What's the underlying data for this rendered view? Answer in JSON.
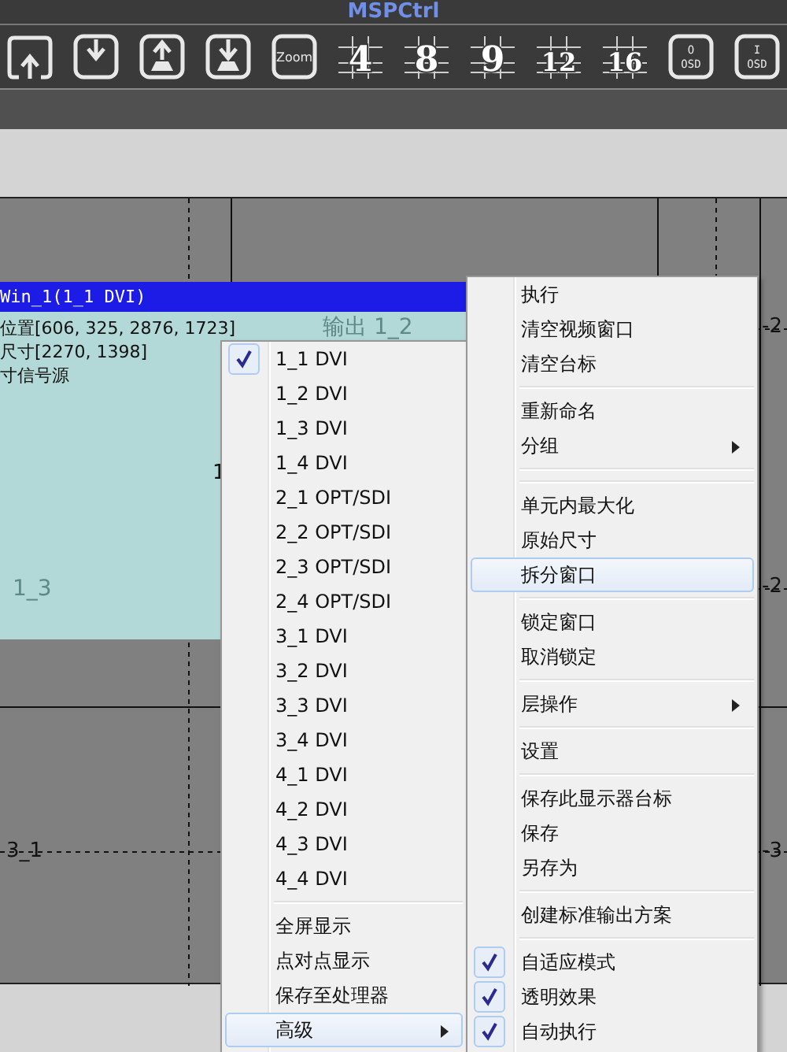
{
  "window": {
    "title": "MSPCtrl"
  },
  "toolbar": [
    {
      "kind": "frame-up"
    },
    {
      "kind": "tray-down"
    },
    {
      "kind": "tray-up"
    },
    {
      "kind": "tray-in"
    },
    {
      "kind": "zoom",
      "label": "Zoom"
    },
    {
      "kind": "grid",
      "label": "4"
    },
    {
      "kind": "grid",
      "label": "8"
    },
    {
      "kind": "grid",
      "label": "9"
    },
    {
      "kind": "grid",
      "label": "12"
    },
    {
      "kind": "grid",
      "label": "16"
    },
    {
      "kind": "osd",
      "label": "O",
      "sub": "OSD"
    },
    {
      "kind": "osd",
      "label": "I",
      "sub": "OSD"
    }
  ],
  "canvas": {
    "labels": [
      "输出 1_2",
      "1",
      "1_3",
      "-2",
      "-2",
      "3_1",
      "-3"
    ],
    "video_window": {
      "title": "Win_1(1_1 DVI)",
      "lines": [
        "位置[606, 325, 2876, 1723]",
        "尺寸[2270, 1398]",
        "寸信号源"
      ]
    }
  },
  "source_menu": {
    "items": [
      {
        "kind": "item",
        "label": "1_1 DVI",
        "checked": true,
        "selected": false,
        "submenu": false
      },
      {
        "kind": "item",
        "label": "1_2 DVI",
        "checked": false,
        "selected": false,
        "submenu": false
      },
      {
        "kind": "item",
        "label": "1_3 DVI",
        "checked": false,
        "selected": false,
        "submenu": false
      },
      {
        "kind": "item",
        "label": "1_4 DVI",
        "checked": false,
        "selected": false,
        "submenu": false
      },
      {
        "kind": "item",
        "label": "2_1 OPT/SDI",
        "checked": false,
        "selected": false,
        "submenu": false
      },
      {
        "kind": "item",
        "label": "2_2 OPT/SDI",
        "checked": false,
        "selected": false,
        "submenu": false
      },
      {
        "kind": "item",
        "label": "2_3 OPT/SDI",
        "checked": false,
        "selected": false,
        "submenu": false
      },
      {
        "kind": "item",
        "label": "2_4 OPT/SDI",
        "checked": false,
        "selected": false,
        "submenu": false
      },
      {
        "kind": "item",
        "label": "3_1 DVI",
        "checked": false,
        "selected": false,
        "submenu": false
      },
      {
        "kind": "item",
        "label": "3_2 DVI",
        "checked": false,
        "selected": false,
        "submenu": false
      },
      {
        "kind": "item",
        "label": "3_3 DVI",
        "checked": false,
        "selected": false,
        "submenu": false
      },
      {
        "kind": "item",
        "label": "3_4 DVI",
        "checked": false,
        "selected": false,
        "submenu": false
      },
      {
        "kind": "item",
        "label": "4_1 DVI",
        "checked": false,
        "selected": false,
        "submenu": false
      },
      {
        "kind": "item",
        "label": "4_2 DVI",
        "checked": false,
        "selected": false,
        "submenu": false
      },
      {
        "kind": "item",
        "label": "4_3 DVI",
        "checked": false,
        "selected": false,
        "submenu": false
      },
      {
        "kind": "item",
        "label": "4_4 DVI",
        "checked": false,
        "selected": false,
        "submenu": false
      },
      {
        "kind": "separator"
      },
      {
        "kind": "item",
        "label": "全屏显示",
        "checked": false,
        "selected": false,
        "submenu": false
      },
      {
        "kind": "item",
        "label": "点对点显示",
        "checked": false,
        "selected": false,
        "submenu": false
      },
      {
        "kind": "item",
        "label": "保存至处理器",
        "checked": false,
        "selected": false,
        "submenu": false
      },
      {
        "kind": "item",
        "label": "高级",
        "checked": false,
        "selected": true,
        "submenu": true
      }
    ]
  },
  "context_menu": {
    "items": [
      {
        "kind": "item",
        "label": "执行",
        "checked": false,
        "selected": false,
        "submenu": false
      },
      {
        "kind": "item",
        "label": "清空视频窗口",
        "checked": false,
        "selected": false,
        "submenu": false
      },
      {
        "kind": "item",
        "label": "清空台标",
        "checked": false,
        "selected": false,
        "submenu": false
      },
      {
        "kind": "separator"
      },
      {
        "kind": "item",
        "label": "重新命名",
        "checked": false,
        "selected": false,
        "submenu": false
      },
      {
        "kind": "item",
        "label": "分组",
        "checked": false,
        "selected": false,
        "submenu": true
      },
      {
        "kind": "separator"
      },
      {
        "kind": "separator"
      },
      {
        "kind": "item",
        "label": "单元内最大化",
        "checked": false,
        "selected": false,
        "submenu": false
      },
      {
        "kind": "item",
        "label": "原始尺寸",
        "checked": false,
        "selected": false,
        "submenu": false
      },
      {
        "kind": "item",
        "label": "拆分窗口",
        "checked": false,
        "selected": true,
        "submenu": false
      },
      {
        "kind": "separator"
      },
      {
        "kind": "item",
        "label": "锁定窗口",
        "checked": false,
        "selected": false,
        "submenu": false
      },
      {
        "kind": "item",
        "label": "取消锁定",
        "checked": false,
        "selected": false,
        "submenu": false
      },
      {
        "kind": "separator"
      },
      {
        "kind": "item",
        "label": "层操作",
        "checked": false,
        "selected": false,
        "submenu": true
      },
      {
        "kind": "separator"
      },
      {
        "kind": "item",
        "label": "设置",
        "checked": false,
        "selected": false,
        "submenu": false
      },
      {
        "kind": "separator"
      },
      {
        "kind": "item",
        "label": "保存此显示器台标",
        "checked": false,
        "selected": false,
        "submenu": false
      },
      {
        "kind": "item",
        "label": "保存",
        "checked": false,
        "selected": false,
        "submenu": false
      },
      {
        "kind": "item",
        "label": "另存为",
        "checked": false,
        "selected": false,
        "submenu": false
      },
      {
        "kind": "separator"
      },
      {
        "kind": "item",
        "label": "创建标准输出方案",
        "checked": false,
        "selected": false,
        "submenu": false
      },
      {
        "kind": "separator"
      },
      {
        "kind": "item",
        "label": "自适应模式",
        "checked": true,
        "selected": false,
        "submenu": false
      },
      {
        "kind": "item",
        "label": "透明效果",
        "checked": true,
        "selected": false,
        "submenu": false
      },
      {
        "kind": "item",
        "label": "自动执行",
        "checked": true,
        "selected": false,
        "submenu": false
      }
    ]
  }
}
